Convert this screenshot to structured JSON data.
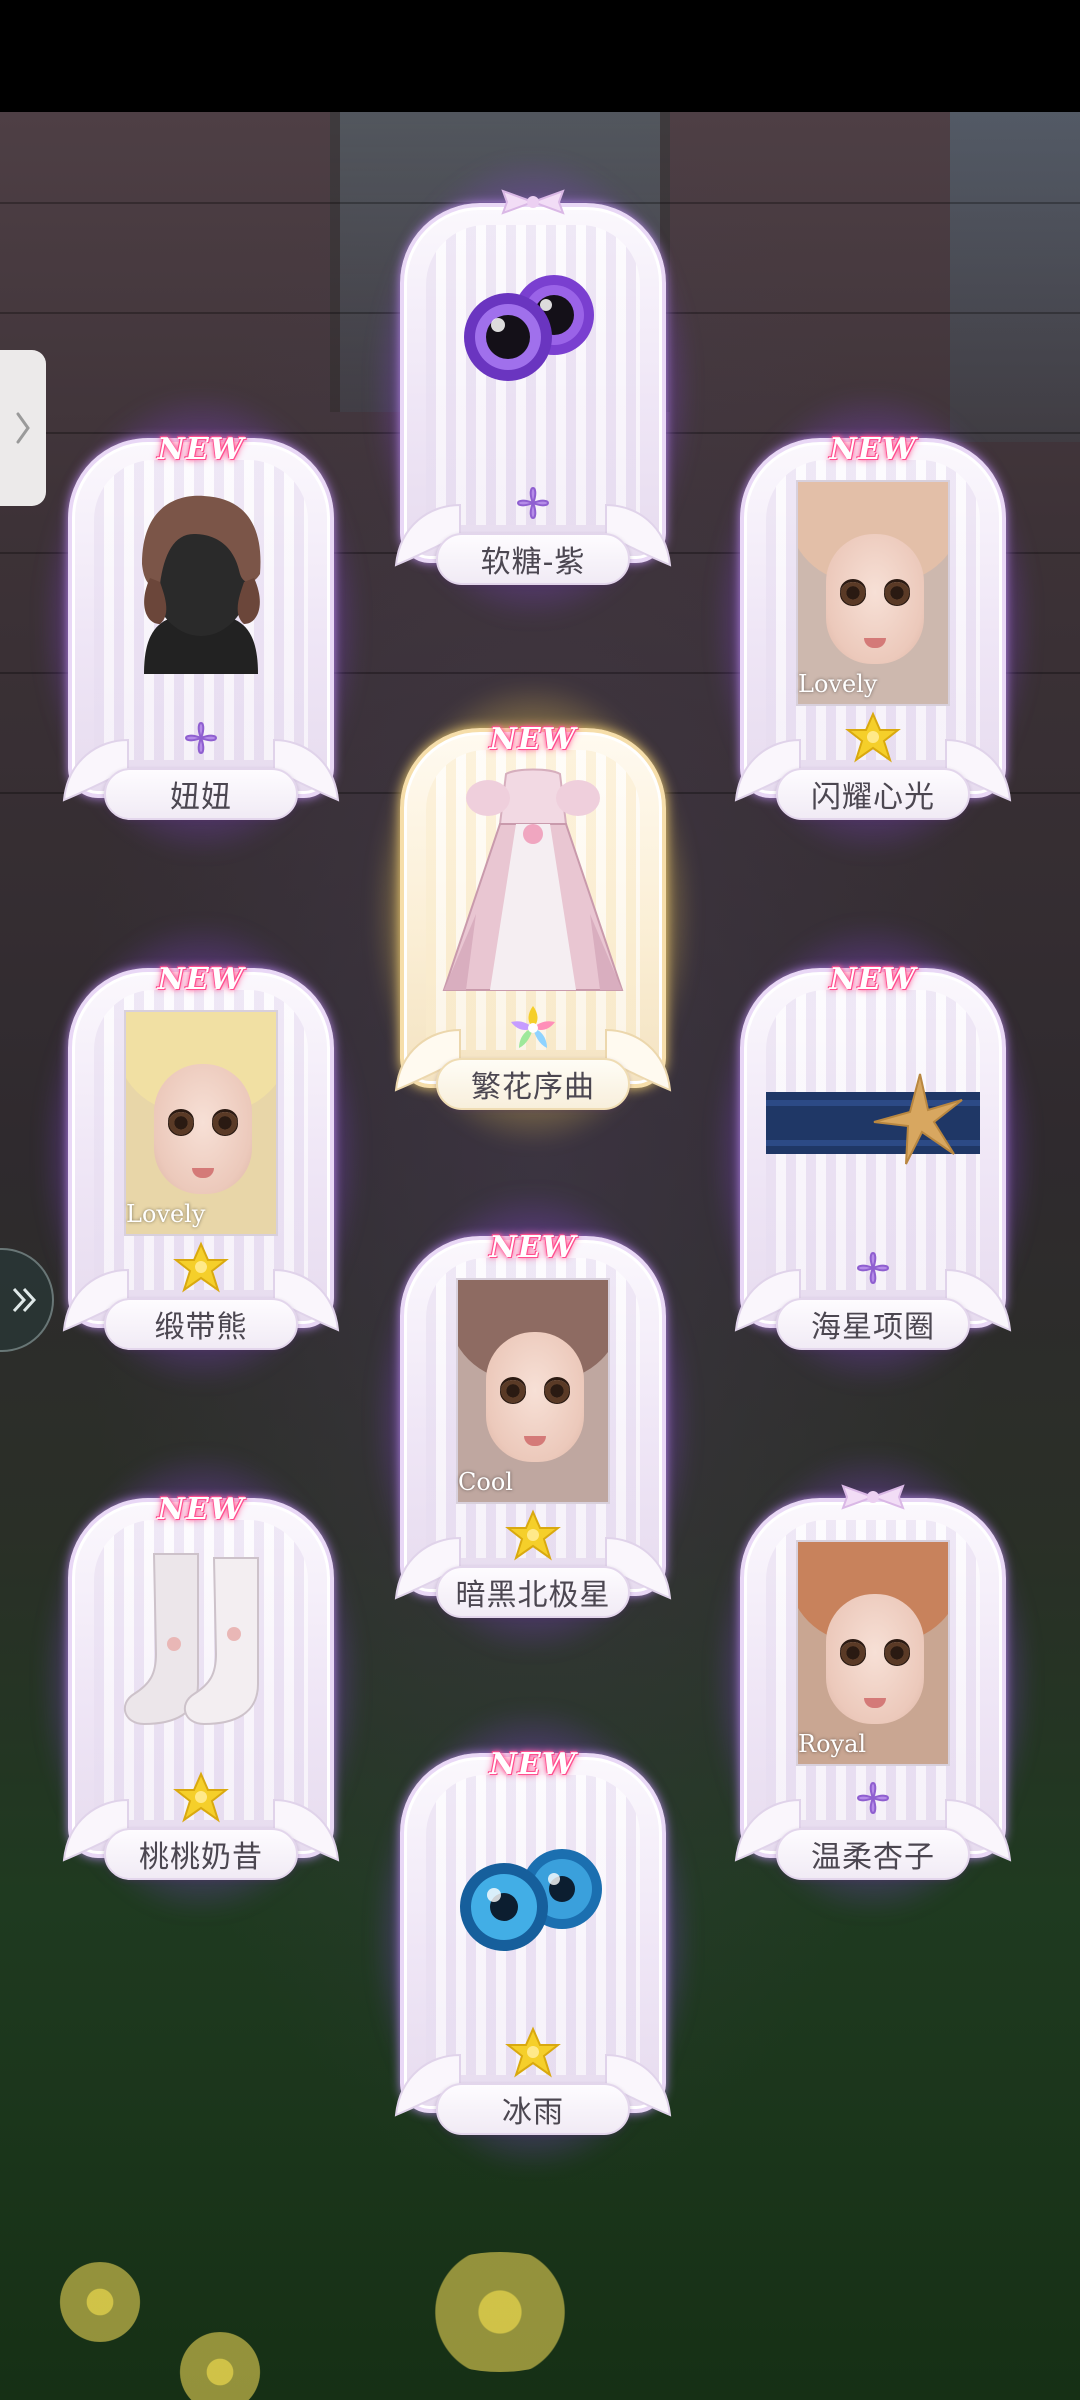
{
  "side_controls": {
    "collapse_icon": "chevron-right-icon",
    "expand_icon": "double-chevron-right-icon"
  },
  "badge_text": "NEW",
  "cards": [
    {
      "id": "ruantang",
      "name": "软糖-紫",
      "is_new": false,
      "item_type": "eyes",
      "rarity": "purple-flower",
      "glow": "purple"
    },
    {
      "id": "niuniu",
      "name": "妞妞",
      "is_new": true,
      "item_type": "hair",
      "rarity": "purple-flower",
      "glow": "purple"
    },
    {
      "id": "shanyao",
      "name": "闪耀心光",
      "is_new": true,
      "item_type": "makeup",
      "style_tag": "Lovely",
      "rarity": "gold-flower",
      "glow": "purple"
    },
    {
      "id": "fanhua",
      "name": "繁花序曲",
      "is_new": true,
      "item_type": "dress",
      "rarity": "rainbow-flower",
      "glow": "gold"
    },
    {
      "id": "duandai",
      "name": "缎带熊",
      "is_new": true,
      "item_type": "makeup",
      "style_tag": "Lovely",
      "rarity": "gold-flower",
      "glow": "purple"
    },
    {
      "id": "haixing",
      "name": "海星项圈",
      "is_new": true,
      "item_type": "choker",
      "rarity": "purple-flower",
      "glow": "purple"
    },
    {
      "id": "anhei",
      "name": "暗黑北极星",
      "is_new": true,
      "item_type": "makeup",
      "style_tag": "Cool",
      "rarity": "gold-flower",
      "glow": "purple"
    },
    {
      "id": "taotao",
      "name": "桃桃奶昔",
      "is_new": true,
      "item_type": "socks",
      "rarity": "gold-flower",
      "glow": "purple"
    },
    {
      "id": "wenrou",
      "name": "温柔杏子",
      "is_new": false,
      "item_type": "makeup",
      "style_tag": "Royal",
      "rarity": "purple-flower",
      "glow": "purple"
    },
    {
      "id": "bingyu",
      "name": "冰雨",
      "is_new": true,
      "item_type": "eyes",
      "rarity": "gold-flower",
      "glow": "purple"
    }
  ],
  "colors": {
    "purple_glow": "#a05aff",
    "gold_glow": "#ffe678",
    "new_badge": "#ff4d8d",
    "gold_flower": "#f5cf2a",
    "purple_flower": "#b58ce8"
  }
}
